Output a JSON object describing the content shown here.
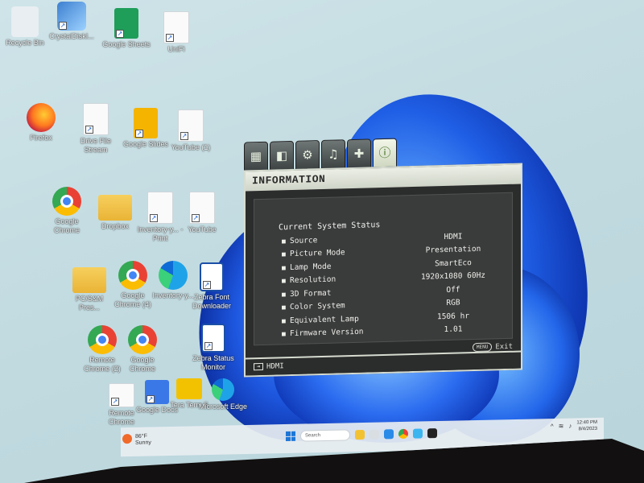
{
  "desktop_icons": [
    {
      "id": "recycle",
      "label": "Recycle Bin",
      "icon": "recycle-bin-icon"
    },
    {
      "id": "crystal",
      "label": "CrystalDiskI...",
      "icon": "crystaldisk-icon"
    },
    {
      "id": "sheets",
      "label": "Google Sheets",
      "icon": "google-sheets-icon"
    },
    {
      "id": "unifi",
      "label": "UniFi",
      "icon": "document-icon"
    },
    {
      "id": "firefox",
      "label": "Firefox",
      "icon": "firefox-icon"
    },
    {
      "id": "drive",
      "label": "Drive File Stream",
      "icon": "document-icon"
    },
    {
      "id": "slides",
      "label": "Google Slides",
      "icon": "google-slides-icon"
    },
    {
      "id": "youtube",
      "label": "YouTube (1)",
      "icon": "document-icon"
    },
    {
      "id": "chrome1",
      "label": "Google Chrome",
      "icon": "chrome-icon"
    },
    {
      "id": "dropbox",
      "label": "Dropbox",
      "icon": "folder-icon"
    },
    {
      "id": "inventory1",
      "label": "Inventory-y... - Print",
      "icon": "document-icon"
    },
    {
      "id": "youtube2",
      "label": "YouTube",
      "icon": "document-icon"
    },
    {
      "id": "pcstuff",
      "label": "PC/S&M Pres...",
      "icon": "folder-icon"
    },
    {
      "id": "chrome2",
      "label": "Google Chrome (4)",
      "icon": "chrome-icon"
    },
    {
      "id": "inventory2",
      "label": "Inventory-y...",
      "icon": "edge-icon"
    },
    {
      "id": "zebrafont",
      "label": "Zebra Font Downloader",
      "icon": "zebra-icon"
    },
    {
      "id": "chrome3",
      "label": "Remote Chrome (2)",
      "icon": "chrome-icon"
    },
    {
      "id": "chrome4",
      "label": "Google Chrome",
      "icon": "chrome-icon"
    },
    {
      "id": "zebrastatus",
      "label": "Zebra Status Monitor",
      "icon": "zebra-icon"
    },
    {
      "id": "remote",
      "label": "Remote Chrome",
      "icon": "document-icon"
    },
    {
      "id": "gdocs",
      "label": "Google Docs",
      "icon": "google-docs-icon"
    },
    {
      "id": "teraterm",
      "label": "Tera Term 5",
      "icon": "teraterm-icon"
    },
    {
      "id": "edge",
      "label": "Microsoft Edge",
      "icon": "edge-icon"
    }
  ],
  "osd": {
    "tabs": [
      {
        "icon": "picture-tab-icon"
      },
      {
        "icon": "image-adjust-tab-icon"
      },
      {
        "icon": "settings-tab-icon"
      },
      {
        "icon": "audio-tab-icon"
      },
      {
        "icon": "advanced-tab-icon"
      },
      {
        "icon": "information-tab-icon",
        "active": true
      }
    ],
    "title": "INFORMATION",
    "heading": "Current System Status",
    "rows": [
      {
        "key": "Source",
        "value": "HDMI"
      },
      {
        "key": "Picture Mode",
        "value": "Presentation"
      },
      {
        "key": "Lamp Mode",
        "value": "SmartEco"
      },
      {
        "key": "Resolution",
        "value": "1920x1080 60Hz"
      },
      {
        "key": "3D Format",
        "value": "Off"
      },
      {
        "key": "Color System",
        "value": "RGB"
      },
      {
        "key": "Equivalent Lamp",
        "value": "1506 hr"
      },
      {
        "key": "Firmware Version",
        "value": "1.01"
      }
    ],
    "exit_key": "MENU",
    "exit_label": "Exit",
    "footer_source": "HDMI"
  },
  "taskbar": {
    "weather_temp": "86°F",
    "weather_desc": "Sunny",
    "search_placeholder": "Search",
    "time": "12:40 PM",
    "date": "8/4/2023"
  },
  "colors": {
    "osd_background": "#2b2c2c",
    "osd_title_bar": "#dfe3d8",
    "wallpaper_blue": "#1f5fe6",
    "active_tab_icon": "#3b6a1a"
  }
}
